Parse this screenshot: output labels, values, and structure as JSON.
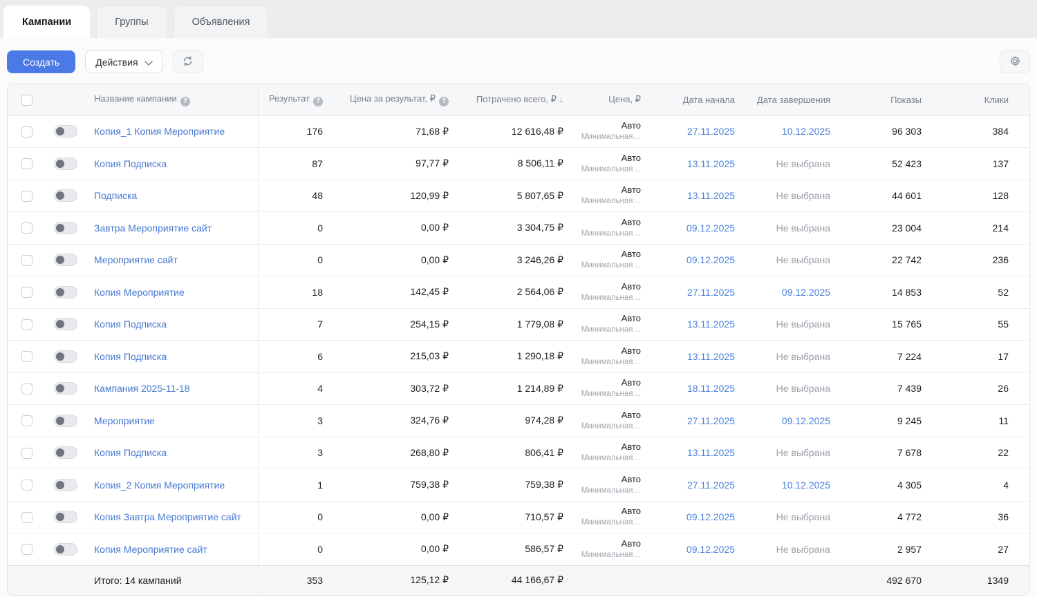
{
  "tabs": [
    {
      "label": "Кампании",
      "active": true
    },
    {
      "label": "Группы",
      "active": false
    },
    {
      "label": "Объявления",
      "active": false
    }
  ],
  "toolbar": {
    "create_label": "Создать",
    "actions_label": "Действия"
  },
  "icons": {
    "help": "?",
    "sort_desc": "↓",
    "refresh": "refresh-icon",
    "settings": "gear-icon",
    "chevron": "chevron-down-icon"
  },
  "colors": {
    "accent_blue": "#4b79e5",
    "link_blue": "#4a80d9",
    "muted_gray": "#9ba0a8"
  },
  "table": {
    "headers": {
      "name": "Название кампании",
      "result": "Результат",
      "cost_per_result": "Цена за результат, ₽",
      "spent": "Потрачено всего, ₽",
      "price": "Цена, ₽",
      "start_date": "Дата начала",
      "end_date": "Дата завершения",
      "impressions": "Показы",
      "clicks": "Клики"
    },
    "rows": [
      {
        "enabled": false,
        "name": "Копия_1 Копия Мероприятие",
        "result": "176",
        "cost_per_result": "71,68 ₽",
        "spent": "12 616,48 ₽",
        "price": "Авто",
        "price_sub": "Минимальная…",
        "start_date": "27.11.2025",
        "end_date": "10.12.2025",
        "end_date_set": true,
        "impressions": "96 303",
        "clicks": "384"
      },
      {
        "enabled": false,
        "name": "Копия Подписка",
        "result": "87",
        "cost_per_result": "97,77 ₽",
        "spent": "8 506,11 ₽",
        "price": "Авто",
        "price_sub": "Минимальная…",
        "start_date": "13.11.2025",
        "end_date": "Не выбрана",
        "end_date_set": false,
        "impressions": "52 423",
        "clicks": "137"
      },
      {
        "enabled": false,
        "name": "Подписка",
        "result": "48",
        "cost_per_result": "120,99 ₽",
        "spent": "5 807,65 ₽",
        "price": "Авто",
        "price_sub": "Минимальная…",
        "start_date": "13.11.2025",
        "end_date": "Не выбрана",
        "end_date_set": false,
        "impressions": "44 601",
        "clicks": "128"
      },
      {
        "enabled": false,
        "name": "Завтра Мероприятие сайт",
        "result": "0",
        "cost_per_result": "0,00 ₽",
        "spent": "3 304,75 ₽",
        "price": "Авто",
        "price_sub": "Минимальная…",
        "start_date": "09.12.2025",
        "end_date": "Не выбрана",
        "end_date_set": false,
        "impressions": "23 004",
        "clicks": "214"
      },
      {
        "enabled": false,
        "name": "Мероприятие сайт",
        "result": "0",
        "cost_per_result": "0,00 ₽",
        "spent": "3 246,26 ₽",
        "price": "Авто",
        "price_sub": "Минимальная…",
        "start_date": "09.12.2025",
        "end_date": "Не выбрана",
        "end_date_set": false,
        "impressions": "22 742",
        "clicks": "236"
      },
      {
        "enabled": false,
        "name": "Копия Мероприятие",
        "result": "18",
        "cost_per_result": "142,45 ₽",
        "spent": "2 564,06 ₽",
        "price": "Авто",
        "price_sub": "Минимальная…",
        "start_date": "27.11.2025",
        "end_date": "09.12.2025",
        "end_date_set": true,
        "impressions": "14 853",
        "clicks": "52"
      },
      {
        "enabled": false,
        "name": "Копия Подписка",
        "result": "7",
        "cost_per_result": "254,15 ₽",
        "spent": "1 779,08 ₽",
        "price": "Авто",
        "price_sub": "Минимальная…",
        "start_date": "13.11.2025",
        "end_date": "Не выбрана",
        "end_date_set": false,
        "impressions": "15 765",
        "clicks": "55"
      },
      {
        "enabled": false,
        "name": "Копия Подписка",
        "result": "6",
        "cost_per_result": "215,03 ₽",
        "spent": "1 290,18 ₽",
        "price": "Авто",
        "price_sub": "Минимальная…",
        "start_date": "13.11.2025",
        "end_date": "Не выбрана",
        "end_date_set": false,
        "impressions": "7 224",
        "clicks": "17"
      },
      {
        "enabled": false,
        "name": "Кампания 2025-11-18",
        "result": "4",
        "cost_per_result": "303,72 ₽",
        "spent": "1 214,89 ₽",
        "price": "Авто",
        "price_sub": "Минимальная…",
        "start_date": "18.11.2025",
        "end_date": "Не выбрана",
        "end_date_set": false,
        "impressions": "7 439",
        "clicks": "26"
      },
      {
        "enabled": false,
        "name": "Мероприятие",
        "result": "3",
        "cost_per_result": "324,76 ₽",
        "spent": "974,28 ₽",
        "price": "Авто",
        "price_sub": "Минимальная…",
        "start_date": "27.11.2025",
        "end_date": "09.12.2025",
        "end_date_set": true,
        "impressions": "9 245",
        "clicks": "11"
      },
      {
        "enabled": false,
        "name": "Копия Подписка",
        "result": "3",
        "cost_per_result": "268,80 ₽",
        "spent": "806,41 ₽",
        "price": "Авто",
        "price_sub": "Минимальная…",
        "start_date": "13.11.2025",
        "end_date": "Не выбрана",
        "end_date_set": false,
        "impressions": "7 678",
        "clicks": "22"
      },
      {
        "enabled": false,
        "name": "Копия_2 Копия Мероприятие",
        "result": "1",
        "cost_per_result": "759,38 ₽",
        "spent": "759,38 ₽",
        "price": "Авто",
        "price_sub": "Минимальная…",
        "start_date": "27.11.2025",
        "end_date": "10.12.2025",
        "end_date_set": true,
        "impressions": "4 305",
        "clicks": "4"
      },
      {
        "enabled": false,
        "name": "Копия Завтра Мероприятие сайт",
        "result": "0",
        "cost_per_result": "0,00 ₽",
        "spent": "710,57 ₽",
        "price": "Авто",
        "price_sub": "Минимальная…",
        "start_date": "09.12.2025",
        "end_date": "Не выбрана",
        "end_date_set": false,
        "impressions": "4 772",
        "clicks": "36"
      },
      {
        "enabled": false,
        "name": "Копия Мероприятие сайт",
        "result": "0",
        "cost_per_result": "0,00 ₽",
        "spent": "586,57 ₽",
        "price": "Авто",
        "price_sub": "Минимальная…",
        "start_date": "09.12.2025",
        "end_date": "Не выбрана",
        "end_date_set": false,
        "impressions": "2 957",
        "clicks": "27"
      }
    ],
    "footer": {
      "label": "Итого: 14 кампаний",
      "result": "353",
      "cost_per_result": "125,12 ₽",
      "spent": "44 166,67 ₽",
      "impressions": "492 670",
      "clicks": "1349"
    }
  }
}
